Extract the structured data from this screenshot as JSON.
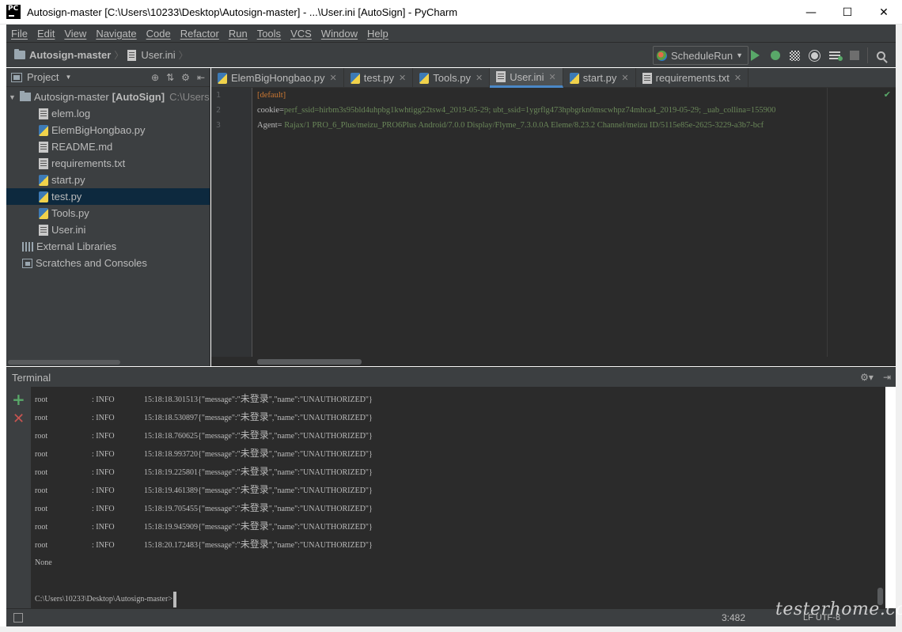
{
  "window": {
    "title": "Autosign-master [C:\\Users\\10233\\Desktop\\Autosign-master] - ...\\User.ini [AutoSign] - PyCharm",
    "logo_text": "PC",
    "controls": {
      "minimize": "—",
      "maximize": "☐",
      "close": "✕"
    }
  },
  "menu": [
    "File",
    "Edit",
    "View",
    "Navigate",
    "Code",
    "Refactor",
    "Run",
    "Tools",
    "VCS",
    "Window",
    "Help"
  ],
  "navbar": {
    "project": "Autosign-master",
    "file": "User.ini",
    "run_config": "ScheduleRun"
  },
  "project_panel": {
    "title": "Project",
    "root_name": "Autosign-master",
    "root_module": "[AutoSign]",
    "root_path": "C:\\Users",
    "files": [
      {
        "name": "elem.log",
        "icon": "text-file-icon"
      },
      {
        "name": "ElemBigHongbao.py",
        "icon": "python-file-icon"
      },
      {
        "name": "README.md",
        "icon": "text-file-icon"
      },
      {
        "name": "requirements.txt",
        "icon": "text-file-icon"
      },
      {
        "name": "start.py",
        "icon": "python-file-icon"
      },
      {
        "name": "test.py",
        "icon": "python-file-icon",
        "selected": true
      },
      {
        "name": "Tools.py",
        "icon": "python-file-icon"
      },
      {
        "name": "User.ini",
        "icon": "ini-file-icon"
      }
    ],
    "external_libraries": "External Libraries",
    "scratches": "Scratches and Consoles"
  },
  "tabs": [
    {
      "label": "ElemBigHongbao.py",
      "icon": "python-file-icon"
    },
    {
      "label": "test.py",
      "icon": "python-file-icon"
    },
    {
      "label": "Tools.py",
      "icon": "python-file-icon"
    },
    {
      "label": "User.ini",
      "icon": "ini-file-icon",
      "active": true
    },
    {
      "label": "start.py",
      "icon": "python-file-icon"
    },
    {
      "label": "requirements.txt",
      "icon": "text-file-icon"
    }
  ],
  "editor": {
    "line_numbers": [
      "1",
      "2",
      "3"
    ],
    "section": "[default]",
    "line2_key": "cookie=",
    "line2_value": "perf_ssid=hirbm3s95bld4uhpbg1kwhtigg22tsw4_2019-05-29; ubt_ssid=1ygrflg473hpbgrkn0mscwhpz74mhca4_2019-05-29; _uab_collina=155900",
    "line3_key": "Agent=",
    "line3_value": " Rajax/1 PRO_6_Plus/meizu_PRO6Plus Android/7.0.0 Display/Flyme_7.3.0.0A Eleme/8.23.2 Channel/meizu ID/5115e85e-2625-3229-a3b7-bcf"
  },
  "terminal": {
    "title": "Terminal",
    "lines": [
      {
        "src": "root",
        "level": ": INFO",
        "time": "15:18:18.301513",
        "pre": "{\"message\":\"",
        "msg": "未登录",
        "post": "\",\"name\":\"UNAUTHORIZED\"}"
      },
      {
        "src": "root",
        "level": ": INFO",
        "time": "15:18:18.530897",
        "pre": "{\"message\":\"",
        "msg": "未登录",
        "post": "\",\"name\":\"UNAUTHORIZED\"}"
      },
      {
        "src": "root",
        "level": ": INFO",
        "time": "15:18:18.760625",
        "pre": "{\"message\":\"",
        "msg": "未登录",
        "post": "\",\"name\":\"UNAUTHORIZED\"}"
      },
      {
        "src": "root",
        "level": ": INFO",
        "time": "15:18:18.993720",
        "pre": "{\"message\":\"",
        "msg": "未登录",
        "post": "\",\"name\":\"UNAUTHORIZED\"}"
      },
      {
        "src": "root",
        "level": ": INFO",
        "time": "15:18:19.225801",
        "pre": "{\"message\":\"",
        "msg": "未登录",
        "post": "\",\"name\":\"UNAUTHORIZED\"}"
      },
      {
        "src": "root",
        "level": ": INFO",
        "time": "15:18:19.461389",
        "pre": "{\"message\":\"",
        "msg": "未登录",
        "post": "\",\"name\":\"UNAUTHORIZED\"}"
      },
      {
        "src": "root",
        "level": ": INFO",
        "time": "15:18:19.705455",
        "pre": "{\"message\":\"",
        "msg": "未登录",
        "post": "\",\"name\":\"UNAUTHORIZED\"}"
      },
      {
        "src": "root",
        "level": ": INFO",
        "time": "15:18:19.945909",
        "pre": "{\"message\":\"",
        "msg": "未登录",
        "post": "\",\"name\":\"UNAUTHORIZED\"}"
      },
      {
        "src": "root",
        "level": ": INFO",
        "time": "15:18:20.172483",
        "pre": "{\"message\":\"",
        "msg": "未登录",
        "post": "\",\"name\":\"UNAUTHORIZED\"}"
      }
    ],
    "none_line": "None",
    "prompt": "C:\\Users\\10233\\Desktop\\Autosign-master>"
  },
  "statusbar": {
    "position": "3:482",
    "encoding_hint": "LF  UTF-8"
  },
  "watermark": "testerhome.com",
  "colors": {
    "ide_bg": "#3c3f41",
    "editor_bg": "#2b2b2b",
    "section": "#cc7832",
    "string_value": "#6a8759",
    "run_green": "#59a869",
    "close_red": "#c75450",
    "active_tab_underline": "#4a88c7"
  }
}
